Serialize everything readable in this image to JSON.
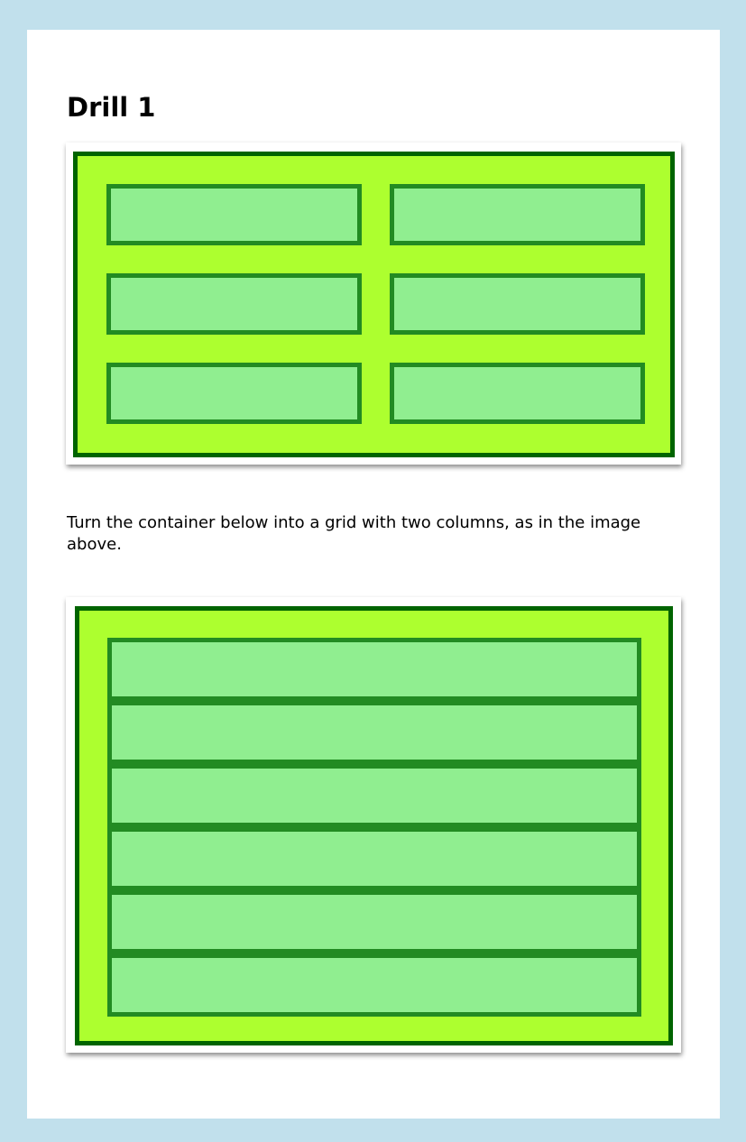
{
  "heading": "Drill 1",
  "instructions": "Turn the container below into a grid with two columns, as in the image above.",
  "colors": {
    "page_background": "#c1e0ec",
    "card_background": "#ffffff",
    "container_fill": "#adff2f",
    "container_border": "#006400",
    "item_fill": "#90ee90",
    "item_border": "#228b22"
  },
  "example": {
    "columns": 2,
    "item_count": 6
  },
  "exercise": {
    "columns": 1,
    "item_count": 6
  }
}
